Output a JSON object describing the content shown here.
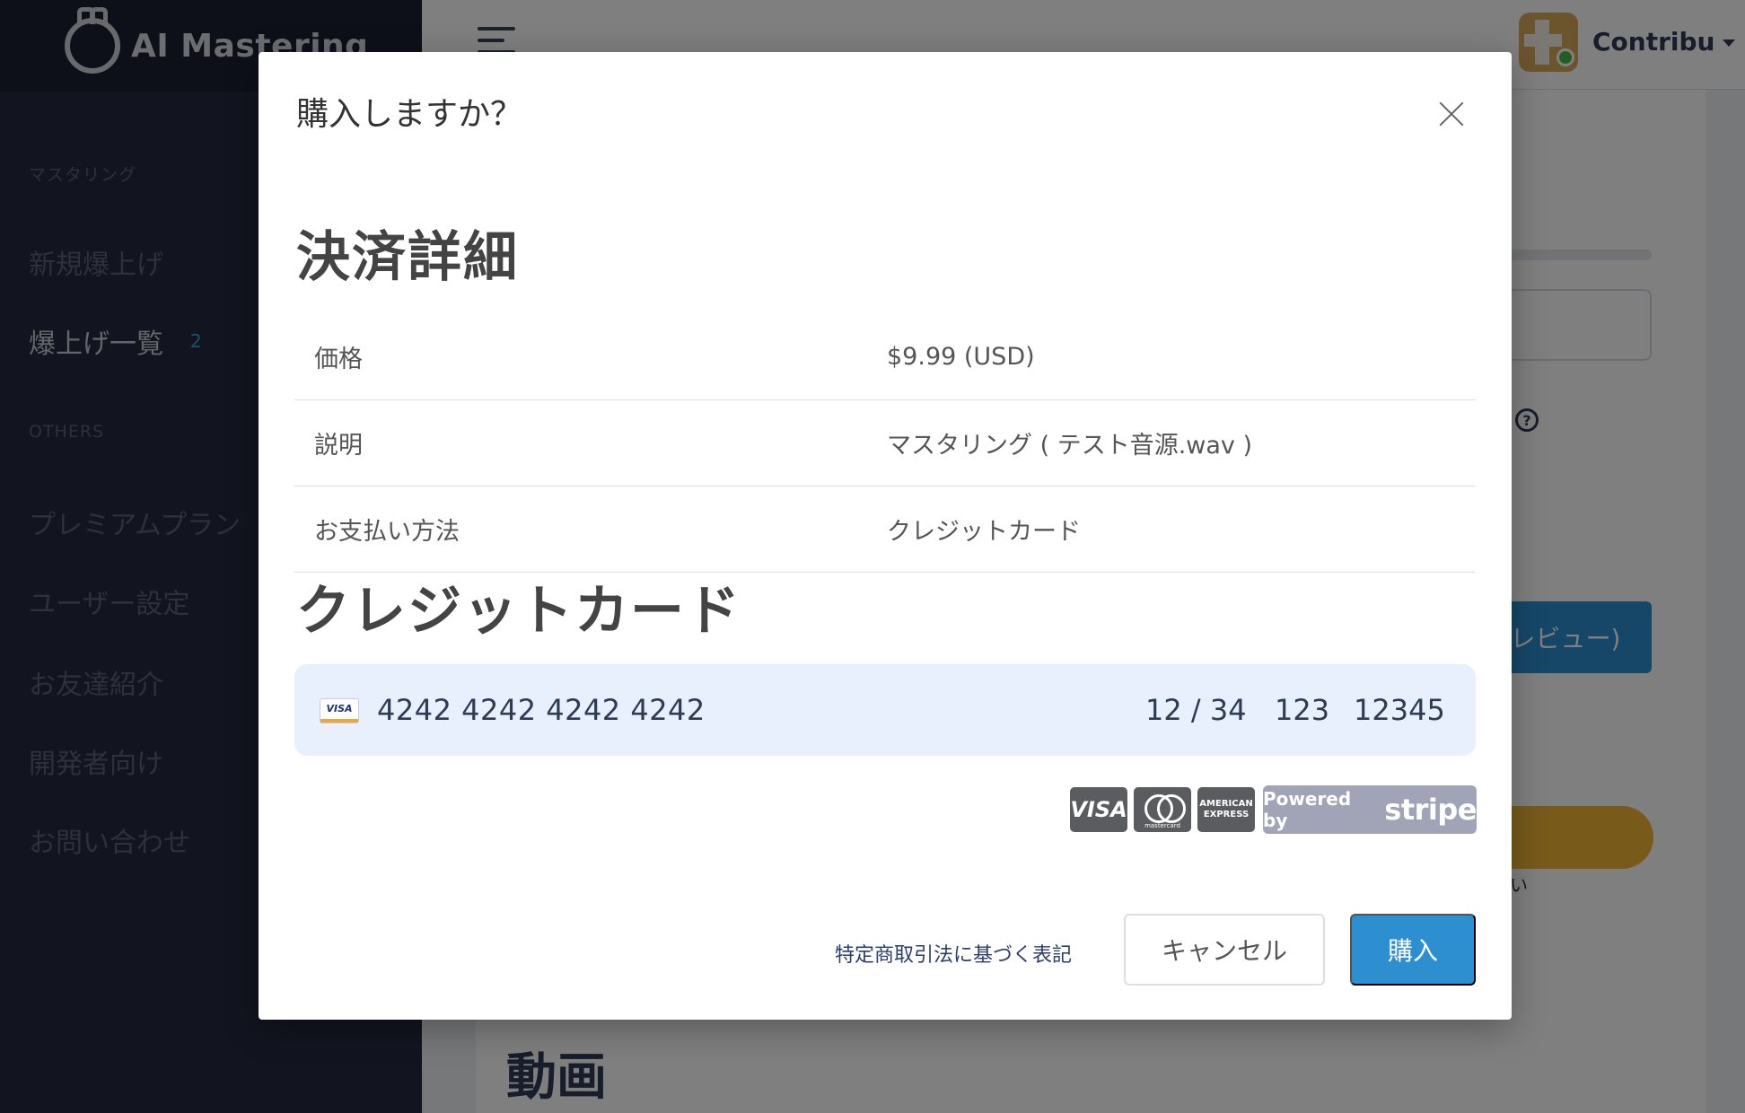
{
  "sidebar": {
    "brand": "AI Mastering",
    "section_mastering": "マスタリング",
    "section_others": "OTHERS",
    "items": [
      {
        "label": "新規爆上げ"
      },
      {
        "label": "爆上げ一覧",
        "badge": "2"
      },
      {
        "label": "プレミアムプラン"
      },
      {
        "label": "ユーザー設定"
      },
      {
        "label": "お友達紹介"
      },
      {
        "label": "開発者向け"
      },
      {
        "label": "お問い合わせ"
      }
    ]
  },
  "header": {
    "user_name": "Contribu"
  },
  "main": {
    "preview_button": "プレビュー)",
    "yellow_caption": "い",
    "video_title": "動画"
  },
  "modal": {
    "title": "購入しますか？",
    "payment_details_heading": "決済詳細",
    "details": [
      {
        "label": "価格",
        "value": "$9.99 (USD)"
      },
      {
        "label": "説明",
        "value": "マスタリング ( テスト音源.wav )"
      },
      {
        "label": "お支払い方法",
        "value": "クレジットカード"
      }
    ],
    "credit_card_heading": "クレジットカード",
    "card": {
      "brand_icon": "VISA",
      "number": "4242 4242 4242 4242",
      "expiry": "12 / 34",
      "cvc": "123",
      "postal": "12345"
    },
    "accepted_brands": {
      "visa": "VISA",
      "mastercard": "mastercard",
      "amex_line1": "AMERICAN",
      "amex_line2": "EXPRESS"
    },
    "stripe_badge": {
      "prefix": "Powered by",
      "word": "stripe"
    },
    "legal_link": "特定商取引法に基づく表記",
    "cancel_button": "キャンセル",
    "buy_button": "購入"
  },
  "colors": {
    "primary": "#2d8fd0",
    "sidebar_bg": "#242a3e",
    "card_field_bg": "#e8f0fd",
    "overlay": "rgba(0,0,0,0.5)"
  }
}
